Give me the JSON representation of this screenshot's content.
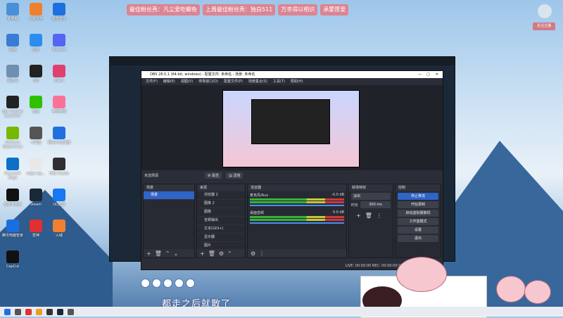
{
  "banner": [
    "最佳粉丝秀：凡尘爱吃鲫鱼",
    "上周最佳粉丝秀：独白511",
    "万幸得以相识",
    "承蒙厚爱"
  ],
  "follow_button": "关注主播",
  "desktop_icons": [
    {
      "label": "此电脑",
      "color": "#4a90d9"
    },
    {
      "label": "火绒安全",
      "color": "#f08030"
    },
    {
      "label": "酷狗音乐",
      "color": "#1d6fe0"
    },
    {
      "label": "网络",
      "color": "#3a7bd5"
    },
    {
      "label": "迅雷",
      "color": "#2d8cf0"
    },
    {
      "label": "Discord",
      "color": "#5865f2"
    },
    {
      "label": "回收站",
      "color": "#6f8fb0"
    },
    {
      "label": "QQ",
      "color": "#222"
    },
    {
      "label": "Clash",
      "color": "#e04070"
    },
    {
      "label": "Epic Games Launcher",
      "color": "#222"
    },
    {
      "label": "微信",
      "color": "#2dc100"
    },
    {
      "label": "哔哩哔哩",
      "color": "#fb7299"
    },
    {
      "label": "GeForce Experience",
      "color": "#76b900"
    },
    {
      "label": "小黑盒",
      "color": "#555"
    },
    {
      "label": "网易UU加速器",
      "color": "#1f6fe0"
    },
    {
      "label": "Microsoft Edge",
      "color": "#0c6fc8"
    },
    {
      "label": "edge-log...",
      "color": "#e8e8e8"
    },
    {
      "label": "OBS Studio",
      "color": "#302e31"
    },
    {
      "label": "剪映专业版",
      "color": "#111"
    },
    {
      "label": "Steam",
      "color": "#1b2838"
    },
    {
      "label": "QQ影音",
      "color": "#1877f2"
    },
    {
      "label": "腾讯电脑管家",
      "color": "#1a6fe0"
    },
    {
      "label": "雷神",
      "color": "#e03030"
    },
    {
      "label": "火绒",
      "color": "#f08030"
    },
    {
      "label": "CapCut",
      "color": "#111"
    }
  ],
  "obs": {
    "title": "OBS 28.0.1 (64-bit, windows) - 配置文件: 未命名 - 场景: 未命名",
    "menu": [
      "文件(F)",
      "编辑(E)",
      "视图(V)",
      "停靠窗口(D)",
      "配置文件(P)",
      "场景集合(S)",
      "工具(T)",
      "帮助(H)"
    ],
    "toolbar": [
      "未选择源",
      "属性",
      "滤镜"
    ],
    "docks": {
      "scenes": "场景",
      "sources": "来源",
      "mixer": "混音器",
      "transitions": "转场特效",
      "controls": "控制"
    },
    "scenes": [
      "场景"
    ],
    "sources": [
      "浏览器 2",
      "图像 2",
      "图像",
      "音频输出",
      "文本(GDI+)",
      "显示器",
      "图片",
      "文本"
    ],
    "mixer": [
      {
        "name": "麦克风/Aux",
        "level": "-0.0 dB"
      },
      {
        "name": "桌面音频",
        "level": "0.0 dB"
      }
    ],
    "transition": {
      "type": "淡出",
      "duration_label": "时长",
      "duration": "300 ms"
    },
    "controls": [
      "停止推流",
      "开始录制",
      "启动虚拟摄像机",
      "工作室模式",
      "设置",
      "退出"
    ],
    "status": "LIVE: 00:00:00   REC: 00:00:00   CPU: 1.0%, 30.00 fps"
  },
  "subtitle": "都走之后就散了"
}
